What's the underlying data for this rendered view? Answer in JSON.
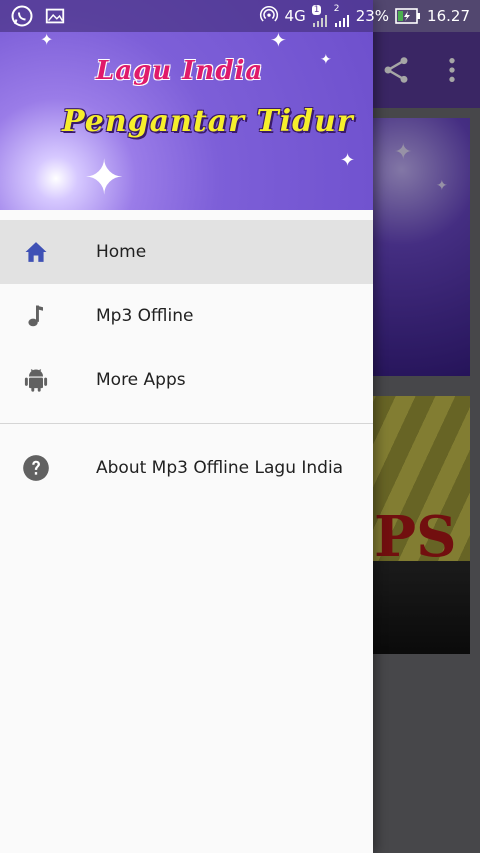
{
  "status_bar": {
    "network": "4G",
    "sim1_badge": "1",
    "sim2_badge": "2",
    "battery": "23%",
    "time": "16.27"
  },
  "drawer": {
    "header_title_line1": "Lagu India",
    "header_title_line2": "Pengantar Tidur",
    "items": [
      {
        "label": "Home",
        "icon": "home-icon",
        "active": true
      },
      {
        "label": "Mp3 Offline",
        "icon": "music-note-icon",
        "active": false
      },
      {
        "label": "More Apps",
        "icon": "android-icon",
        "active": false
      }
    ],
    "about_label": "About Mp3 Offline Lagu India",
    "about_icon": "help-circle-icon"
  },
  "colors": {
    "drawer_bg": "#fafafa",
    "active_item_bg": "#e2e2e2",
    "home_icon": "#3f51b5",
    "icon_gray": "#616161",
    "title_pink": "#e01a6a",
    "title_yellow": "#f6ef2c"
  }
}
